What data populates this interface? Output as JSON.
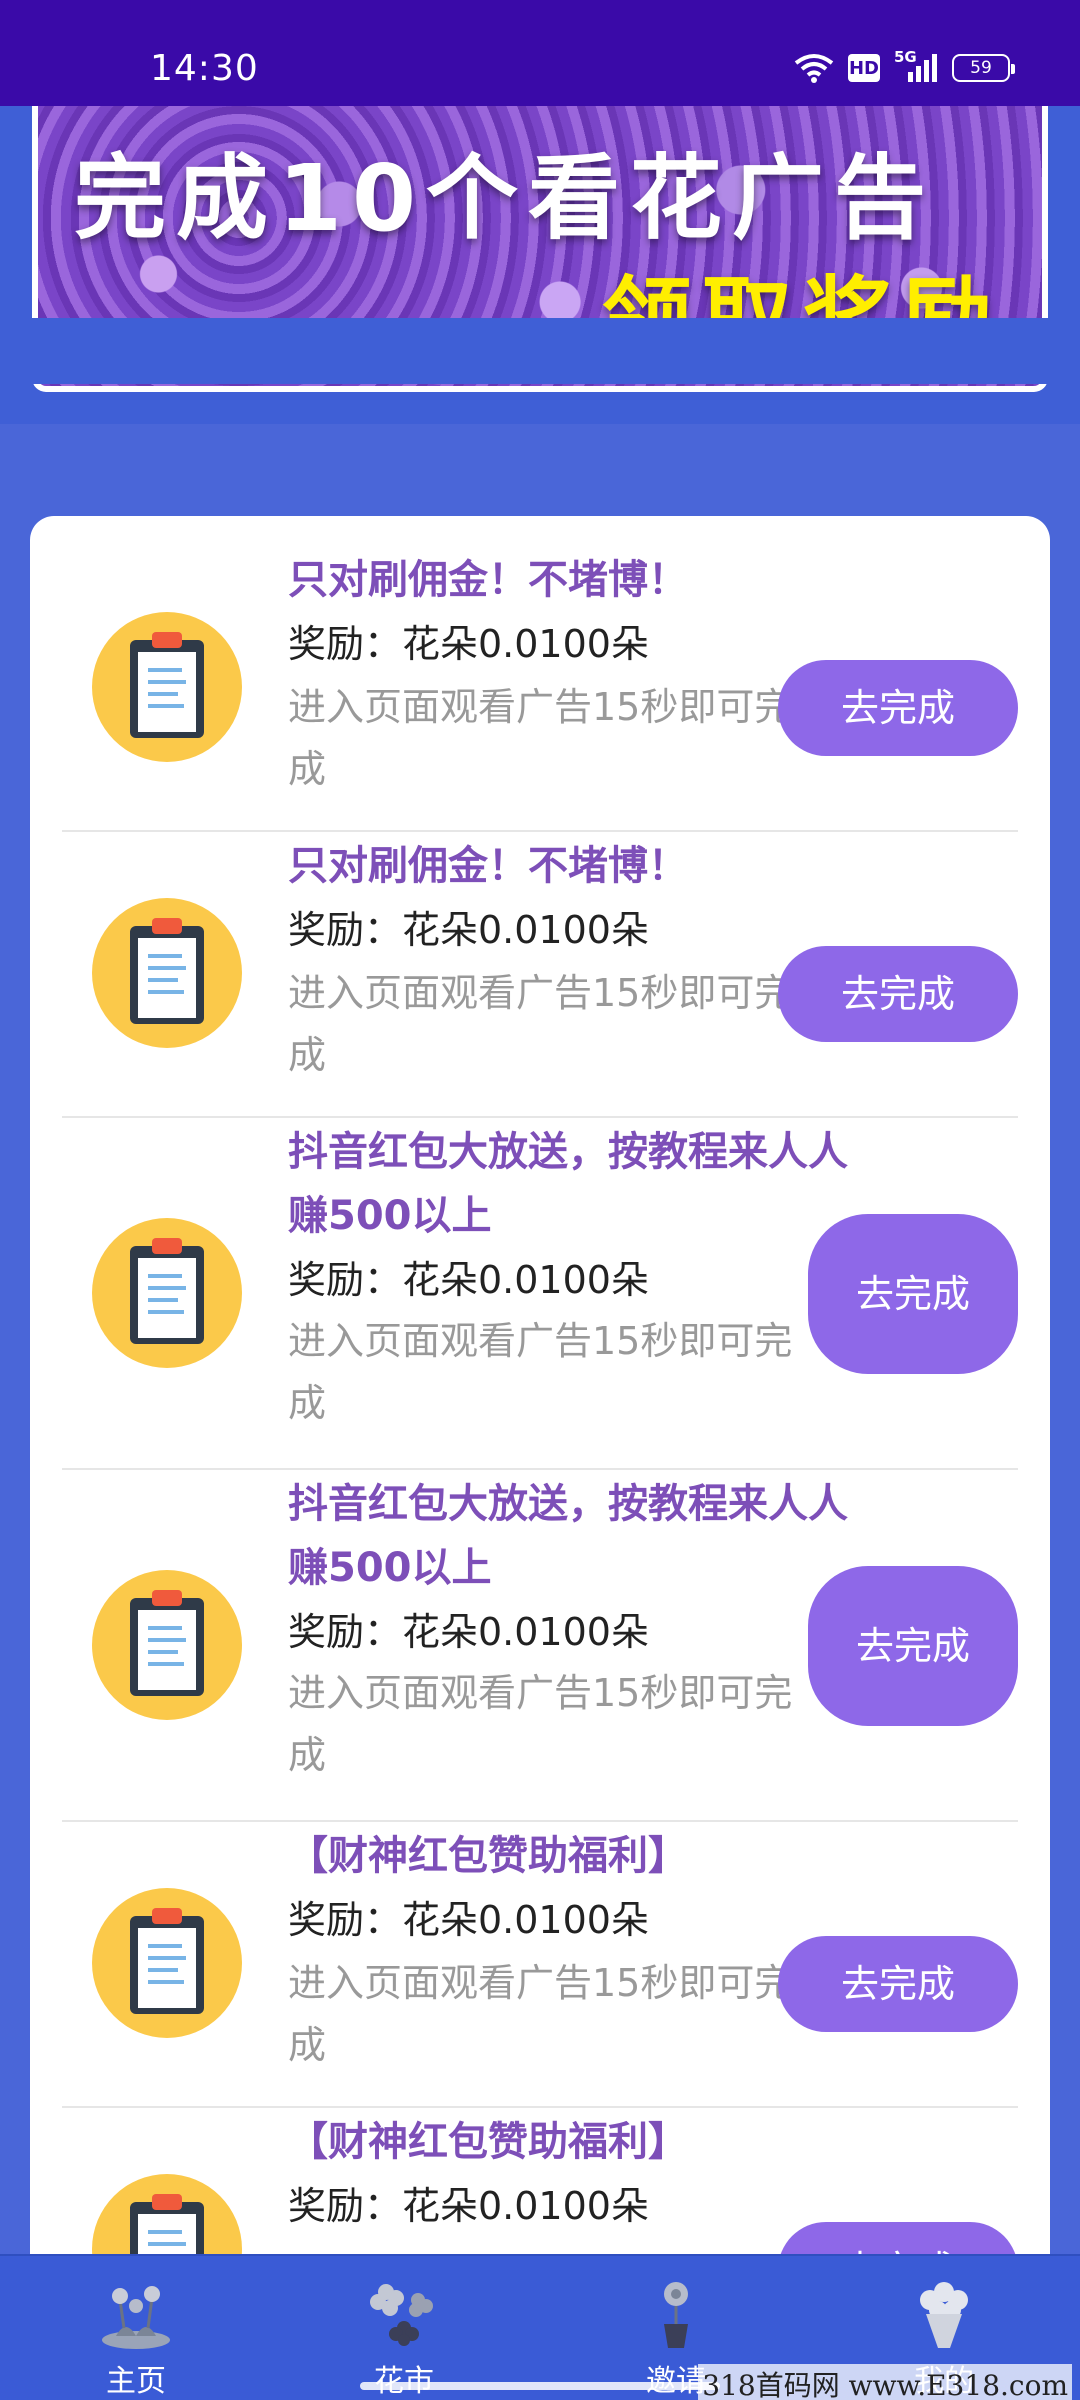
{
  "status_bar": {
    "time": "14:30",
    "network": "5G",
    "hd": "HD",
    "battery": "59"
  },
  "banner": {
    "title": "完成10个看花广告",
    "subtitle": "领取奖励"
  },
  "tasks": [
    {
      "title": "只对刷佣金！不堵博！",
      "reward": "奖励：花朵0.0100朵",
      "desc": "进入页面观看广告15秒即可完成",
      "button": "去完成"
    },
    {
      "title": "只对刷佣金！不堵博！",
      "reward": "奖励：花朵0.0100朵",
      "desc": "进入页面观看广告15秒即可完成",
      "button": "去完成"
    },
    {
      "title": "抖音红包大放送，按教程来人人赚500以上",
      "reward": "奖励：花朵0.0100朵",
      "desc": "进入页面观看广告15秒即可完成",
      "button": "去完成"
    },
    {
      "title": "抖音红包大放送，按教程来人人赚500以上",
      "reward": "奖励：花朵0.0100朵",
      "desc": "进入页面观看广告15秒即可完成",
      "button": "去完成"
    },
    {
      "title": "【财神红包赞助福利】",
      "reward": "奖励：花朵0.0100朵",
      "desc": "进入页面观看广告15秒即可完成",
      "button": "去完成"
    },
    {
      "title": "【财神红包赞助福利】",
      "reward": "奖励：花朵0.0100朵",
      "desc": "",
      "button": "去完成"
    }
  ],
  "nav": [
    {
      "label": "主页",
      "icon": "home-flower-icon"
    },
    {
      "label": "花市",
      "icon": "flower-market-icon"
    },
    {
      "label": "邀请",
      "icon": "potted-flower-icon"
    },
    {
      "label": "我的",
      "icon": "bouquet-icon"
    }
  ],
  "watermark": "318首码网 www.E318.com",
  "colors": {
    "status_bar": "#3a0aa8",
    "background": "#4a66d8",
    "title_purple": "#7d4fb8",
    "button": "#8e68e8",
    "icon_yellow": "#fbc94a",
    "banner_sub": "#ffee00"
  }
}
